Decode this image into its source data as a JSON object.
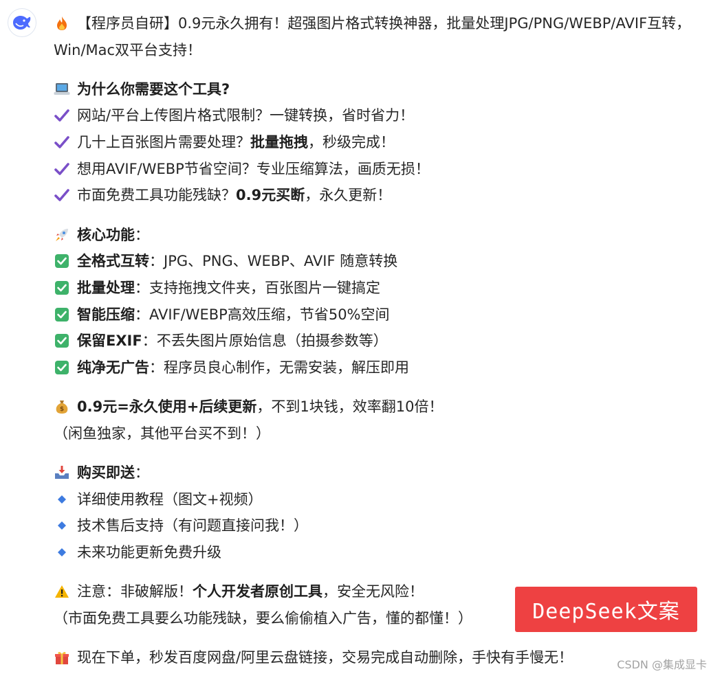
{
  "header": {
    "line1": "【程序员自研】0.9元永久拥有！超强图片格式转换神器，批量处理JPG/PNG/WEBP/AVIF互转，",
    "line2": "Win/Mac双平台支持！"
  },
  "why": {
    "title": "为什么你需要这个工具?",
    "items": [
      {
        "pre": "网站/平台上传图片格式限制？一键转换，省时省力！",
        "bold": "",
        "post": ""
      },
      {
        "pre": "几十上百张图片需要处理？",
        "bold": "批量拖拽",
        "post": "，秒级完成！"
      },
      {
        "pre": "想用AVIF/WEBP节省空间？专业压缩算法，画质无损！",
        "bold": "",
        "post": ""
      },
      {
        "pre": "市面免费工具功能残缺？",
        "bold": "0.9元买断",
        "post": "，永久更新！"
      }
    ]
  },
  "features": {
    "title": "核心功能",
    "title_suffix": "：",
    "items": [
      {
        "bold": "全格式互转",
        "text": "：JPG、PNG、WEBP、AVIF 随意转换"
      },
      {
        "bold": "批量处理",
        "text": "：支持拖拽文件夹，百张图片一键搞定"
      },
      {
        "bold": "智能压缩",
        "text": "：AVIF/WEBP高效压缩，节省50%空间"
      },
      {
        "bold": "保留EXIF",
        "text": "：不丢失图片原始信息（拍摄参数等）"
      },
      {
        "bold": "纯净无广告",
        "text": "：程序员良心制作，无需安装，解压即用"
      }
    ]
  },
  "price": {
    "bold": "0.9元=永久使用+后续更新",
    "text": "，不到1块钱，效率翻10倍！",
    "sub": "（闲鱼独家，其他平台买不到！）"
  },
  "gift": {
    "title": "购买即送",
    "title_suffix": "：",
    "items": [
      "详细使用教程（图文+视频）",
      "技术售后支持（有问题直接问我！）",
      "未来功能更新免费升级"
    ]
  },
  "notice": {
    "pre": "注意：非破解版！",
    "bold": "个人开发者原创工具",
    "post": "，安全无风险！",
    "sub": "（市面免费工具要么功能残缺，要么偷偷植入广告，懂的都懂！）"
  },
  "cta": {
    "text": "现在下单，秒发百度网盘/阿里云盘链接，交易完成自动删除，手快有手慢无！"
  },
  "overlay_label": "DeepSeek文案",
  "watermark": "CSDN @集成显卡",
  "colors": {
    "check_green": "#3eb26a",
    "check_purple": "#7a4fc8",
    "diamond_blue": "#3d7be0",
    "overlay_red": "#ee4142"
  },
  "icons": [
    "deepseek-whale-icon",
    "fire-icon",
    "laptop-icon",
    "heavy-check-icon",
    "rocket-icon",
    "check-box-icon",
    "money-bag-icon",
    "inbox-tray-icon",
    "blue-diamond-icon",
    "warning-icon",
    "gift-icon"
  ]
}
